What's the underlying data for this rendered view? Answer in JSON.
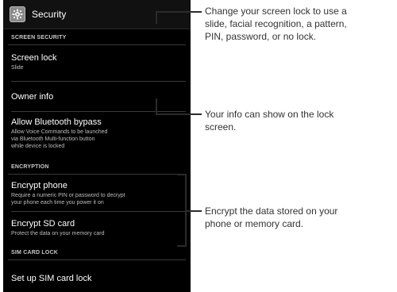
{
  "titlebar": {
    "title": "Security"
  },
  "sections": {
    "screen_security": "SCREEN SECURITY",
    "encryption": "ENCRYPTION",
    "sim_card_lock": "SIM CARD LOCK"
  },
  "items": {
    "screen_lock": {
      "label": "Screen lock",
      "value": "Slide"
    },
    "owner_info": {
      "label": "Owner info"
    },
    "bluetooth_bypass": {
      "label": "Allow Bluetooth bypass",
      "description_lines": [
        "Allow Voice Commands to be launched",
        "via Bluetooth Multi-function button",
        "while device is locked"
      ]
    },
    "encrypt_phone": {
      "label": "Encrypt phone",
      "description_lines": [
        "Require a numeric PIN or password to decrypt",
        "your phone each time you power it on"
      ]
    },
    "encrypt_sd": {
      "label": "Encrypt SD card",
      "description_lines": [
        "Protect the data on your memory card"
      ]
    },
    "sim_lock": {
      "label": "Set up SIM card lock"
    }
  },
  "callouts": {
    "screen_lock": [
      "Change your screen lock to use a",
      "slide, facial recognition, a pattern,",
      "PIN, password, or no lock."
    ],
    "owner_info": [
      "Your info can show on the lock",
      "screen."
    ],
    "encryption": [
      "Encrypt the data stored on your",
      "phone or memory card."
    ]
  },
  "icons": {
    "app_icon": "gear-icon"
  }
}
